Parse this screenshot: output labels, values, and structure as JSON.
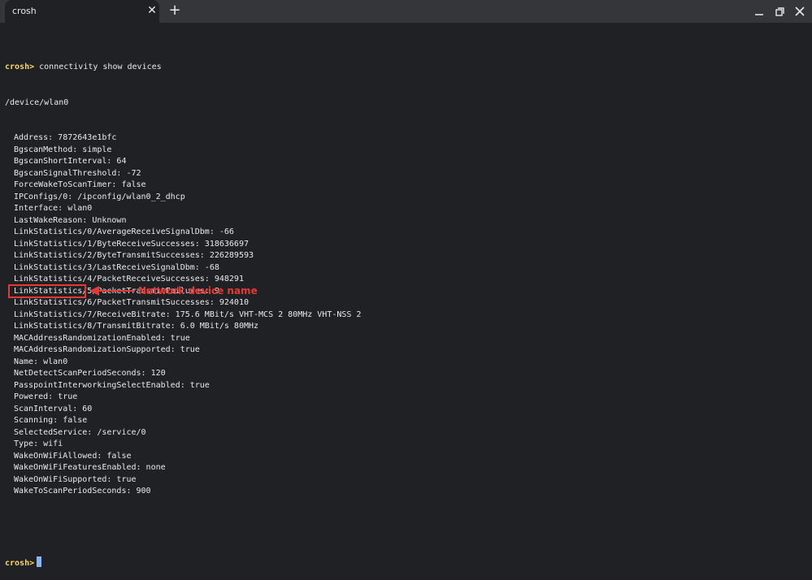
{
  "window": {
    "tab_title": "crosh",
    "tab_close_glyph": "✕",
    "new_tab_glyph": "+",
    "icons": [
      "close-icon",
      "plus-icon",
      "minimize-icon",
      "maximize-icon",
      "close-icon"
    ]
  },
  "terminal": {
    "prompt": "crosh>",
    "command": " connectivity show devices",
    "device_path": "/device/wlan0",
    "lines": [
      "Address: 7872643e1bfc",
      "BgscanMethod: simple",
      "BgscanShortInterval: 64",
      "BgscanSignalThreshold: -72",
      "ForceWakeToScanTimer: false",
      "IPConfigs/0: /ipconfig/wlan0_2_dhcp",
      "Interface: wlan0",
      "LastWakeReason: Unknown",
      "LinkStatistics/0/AverageReceiveSignalDbm: -66",
      "LinkStatistics/1/ByteReceiveSuccesses: 318636697",
      "LinkStatistics/2/ByteTransmitSuccesses: 226289593",
      "LinkStatistics/3/LastReceiveSignalDbm: -68",
      "LinkStatistics/4/PacketReceiveSuccesses: 948291",
      "LinkStatistics/5/PacketTransmitFailures: 9",
      "LinkStatistics/6/PacketTransmitSuccesses: 924010",
      "LinkStatistics/7/ReceiveBitrate: 175.6 MBit/s VHT-MCS 2 80MHz VHT-NSS 2",
      "LinkStatistics/8/TransmitBitrate: 6.0 MBit/s 80MHz",
      "MACAddressRandomizationEnabled: true",
      "MACAddressRandomizationSupported: true",
      "Name: wlan0",
      "NetDetectScanPeriodSeconds: 120",
      "PasspointInterworkingSelectEnabled: true",
      "Powered: true",
      "ScanInterval: 60",
      "Scanning: false",
      "SelectedService: /service/0",
      "Type: wifi",
      "WakeOnWiFiAllowed: false",
      "WakeOnWiFiFeaturesEnabled: none",
      "WakeOnWiFiSupported: true",
      "WakeToScanPeriodSeconds: 900"
    ],
    "final_prompt": "crosh>"
  },
  "annotation": {
    "label": "Network device name",
    "color": "#e53935"
  },
  "colors": {
    "background": "#202124",
    "titlebar": "#35363a",
    "text": "#e8eaed",
    "prompt": "#fdd663",
    "cursor": "#8ab4f8"
  }
}
